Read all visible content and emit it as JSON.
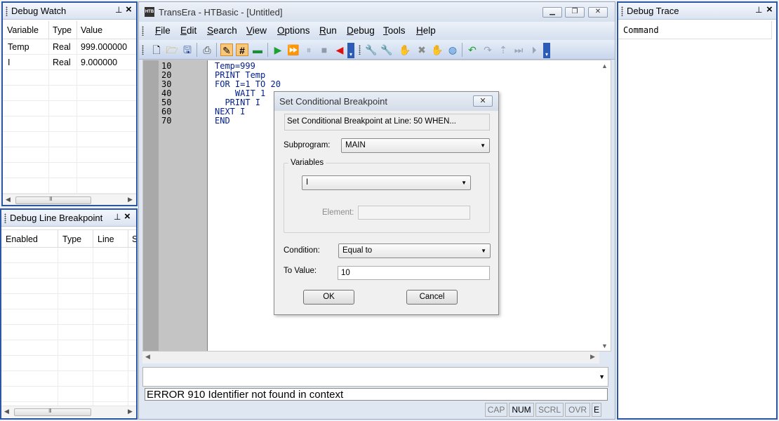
{
  "watch_panel": {
    "title": "Debug Watch",
    "columns": [
      "Variable",
      "Type",
      "Value"
    ],
    "rows": [
      {
        "variable": "Temp",
        "type": "Real",
        "value": "999.000000"
      },
      {
        "variable": "I",
        "type": "Real",
        "value": "9.000000"
      }
    ]
  },
  "breakpoint_panel": {
    "title": "Debug Line Breakpoint",
    "columns": [
      "Enabled",
      "Type",
      "Line",
      "S"
    ]
  },
  "trace_panel": {
    "title": "Debug Trace",
    "columns": [
      "Command"
    ]
  },
  "window": {
    "title": "TransEra - HTBasic - [Untitled]",
    "icon_text": "HTB"
  },
  "menu": [
    {
      "label": "File",
      "ul": "F",
      "rest": "ile"
    },
    {
      "label": "Edit",
      "ul": "E",
      "rest": "dit"
    },
    {
      "label": "Search",
      "ul": "S",
      "rest": "earch"
    },
    {
      "label": "View",
      "ul": "V",
      "rest": "iew"
    },
    {
      "label": "Options",
      "ul": "O",
      "rest": "ptions"
    },
    {
      "label": "Run",
      "ul": "R",
      "rest": "un"
    },
    {
      "label": "Debug",
      "ul": "D",
      "rest": "ebug"
    },
    {
      "label": "Tools",
      "ul": "T",
      "rest": "ools"
    },
    {
      "label": "Help",
      "ul": "H",
      "rest": "elp"
    }
  ],
  "editor": {
    "lines": [
      {
        "no": "10",
        "code": "Temp=999"
      },
      {
        "no": "20",
        "code": "PRINT Temp"
      },
      {
        "no": "30",
        "code": "FOR I=1 TO 20"
      },
      {
        "no": "40",
        "code": "    WAIT 1"
      },
      {
        "no": "50",
        "code": "  PRINT I"
      },
      {
        "no": "60",
        "code": "NEXT I"
      },
      {
        "no": "70",
        "code": "END"
      }
    ]
  },
  "message_line": "ERROR 910 Identifier not found in context",
  "status": {
    "cap": "CAP",
    "num": "NUM",
    "scrl": "SCRL",
    "ovr": "OVR",
    "extra": "E"
  },
  "dialog": {
    "title": "Set Conditional Breakpoint",
    "close_glyph": "✕",
    "header": "Set Conditional Breakpoint at Line: 50  WHEN...",
    "subprogram_label": "Subprogram:",
    "subprogram_value": "MAIN",
    "variables_group_label": "Variables",
    "variable_value": "I",
    "element_label": "Element:",
    "element_value": "",
    "condition_label": "Condition:",
    "condition_value": "Equal to",
    "to_value_label": "To Value:",
    "to_value": "10",
    "ok_label": "OK",
    "cancel_label": "Cancel"
  }
}
